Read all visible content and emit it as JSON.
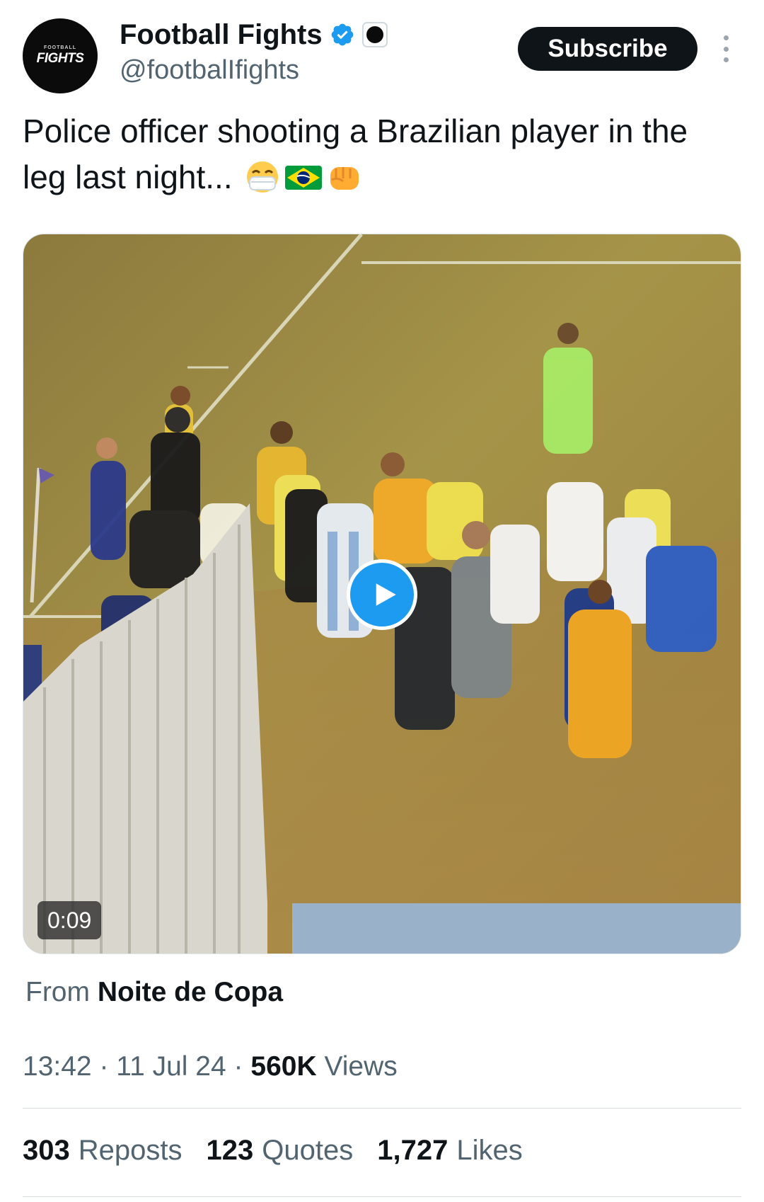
{
  "header": {
    "avatar_text_top": "FOOTBALL",
    "avatar_text_main": "FIGHTS",
    "display_name": "Football Fights",
    "handle": "@footbalIfights",
    "subscribe_label": "Subscribe",
    "verified_icon": "verified-badge-icon",
    "affiliate_icon": "affiliate-badge-icon"
  },
  "tweet": {
    "text": "Police officer shooting a Brazilian player in the leg last night...",
    "emojis": [
      "face-with-medical-mask",
      "brazil-flag",
      "oncoming-fist"
    ]
  },
  "media": {
    "duration": "0:09",
    "type": "video"
  },
  "source": {
    "from_label": "From",
    "from_name": "Noite de Copa"
  },
  "meta": {
    "time": "13:42",
    "separator": "·",
    "date": "11 Jul 24",
    "views_count": "560K",
    "views_label": "Views"
  },
  "stats": {
    "reposts_count": "303",
    "reposts_label": "Reposts",
    "quotes_count": "123",
    "quotes_label": "Quotes",
    "likes_count": "1,727",
    "likes_label": "Likes"
  },
  "colors": {
    "accent": "#1d9bf0",
    "text": "#0f1419",
    "muted": "#536471"
  }
}
